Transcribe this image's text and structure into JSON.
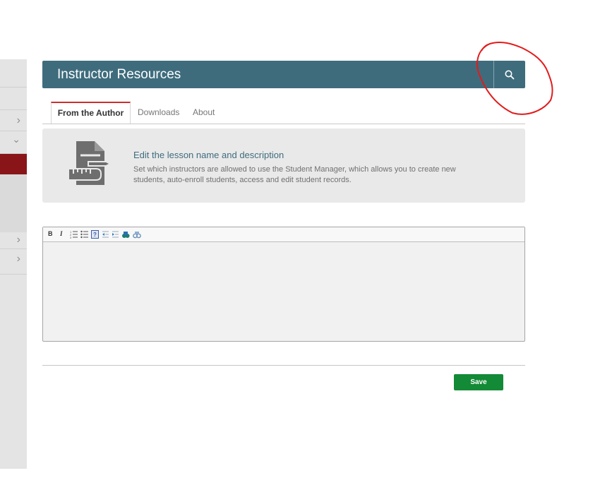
{
  "colors": {
    "header": "#3e6c7d",
    "sidebar_active": "#8a1518",
    "tab_accent": "#c9302c",
    "save_button": "#138a36",
    "annotation": "#e21b1b"
  },
  "header": {
    "title": "Instructor Resources",
    "search_icon": "search-icon"
  },
  "tabs": [
    {
      "label": "From the Author",
      "active": true
    },
    {
      "label": "Downloads",
      "active": false
    },
    {
      "label": "About",
      "active": false
    }
  ],
  "info_panel": {
    "icon": "document-pencil-ruler-icon",
    "title": "Edit the lesson name and description",
    "description": "Set which instructors are allowed to use the Student Manager, which allows you to create new students, auto-enroll students, access and edit student records."
  },
  "editor": {
    "toolbar": {
      "bold": "B",
      "italic": "I",
      "buttons": [
        "bold-icon",
        "italic-icon",
        "numbered-list-icon",
        "bulleted-list-icon",
        "help-icon",
        "outdent-icon",
        "indent-icon",
        "insert-image-icon",
        "find-icon"
      ]
    },
    "content": ""
  },
  "footer": {
    "save_label": "Save"
  },
  "sidebar": {
    "rows": [
      "collapsed",
      "expanded",
      "active",
      "collapsed",
      "collapsed"
    ]
  }
}
